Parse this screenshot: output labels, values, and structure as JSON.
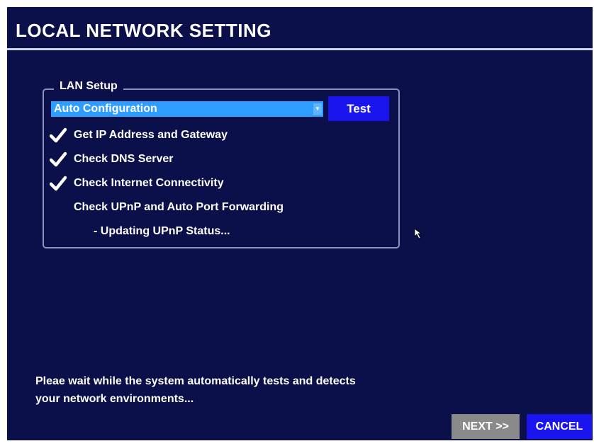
{
  "page": {
    "title": "LOCAL NETWORK SETTING"
  },
  "lan_setup": {
    "legend": "LAN Setup",
    "config_select": {
      "value": "Auto Configuration"
    },
    "test_label": "Test",
    "steps": [
      {
        "label": "Get IP Address and Gateway",
        "checked": true
      },
      {
        "label": "Check DNS Server",
        "checked": true
      },
      {
        "label": "Check Internet Connectivity",
        "checked": true
      },
      {
        "label": "Check UPnP and Auto Port Forwarding",
        "checked": false
      },
      {
        "label": "- Updating UPnP Status...",
        "checked": false
      }
    ]
  },
  "status_message": {
    "line1": "Pleae wait while the system automatically tests and detects",
    "line2": "your network environments..."
  },
  "footer": {
    "next_label": "NEXT >>",
    "cancel_label": "CANCEL"
  },
  "colors": {
    "background": "#0b0f4a",
    "select_highlight": "#2f9cff",
    "button_blue": "#1a14ef",
    "button_disabled": "#8a8a8a"
  },
  "icons": {
    "check": "checkmark-icon",
    "dropdown": "chevron-down-icon",
    "pointer": "mouse-pointer-icon"
  }
}
